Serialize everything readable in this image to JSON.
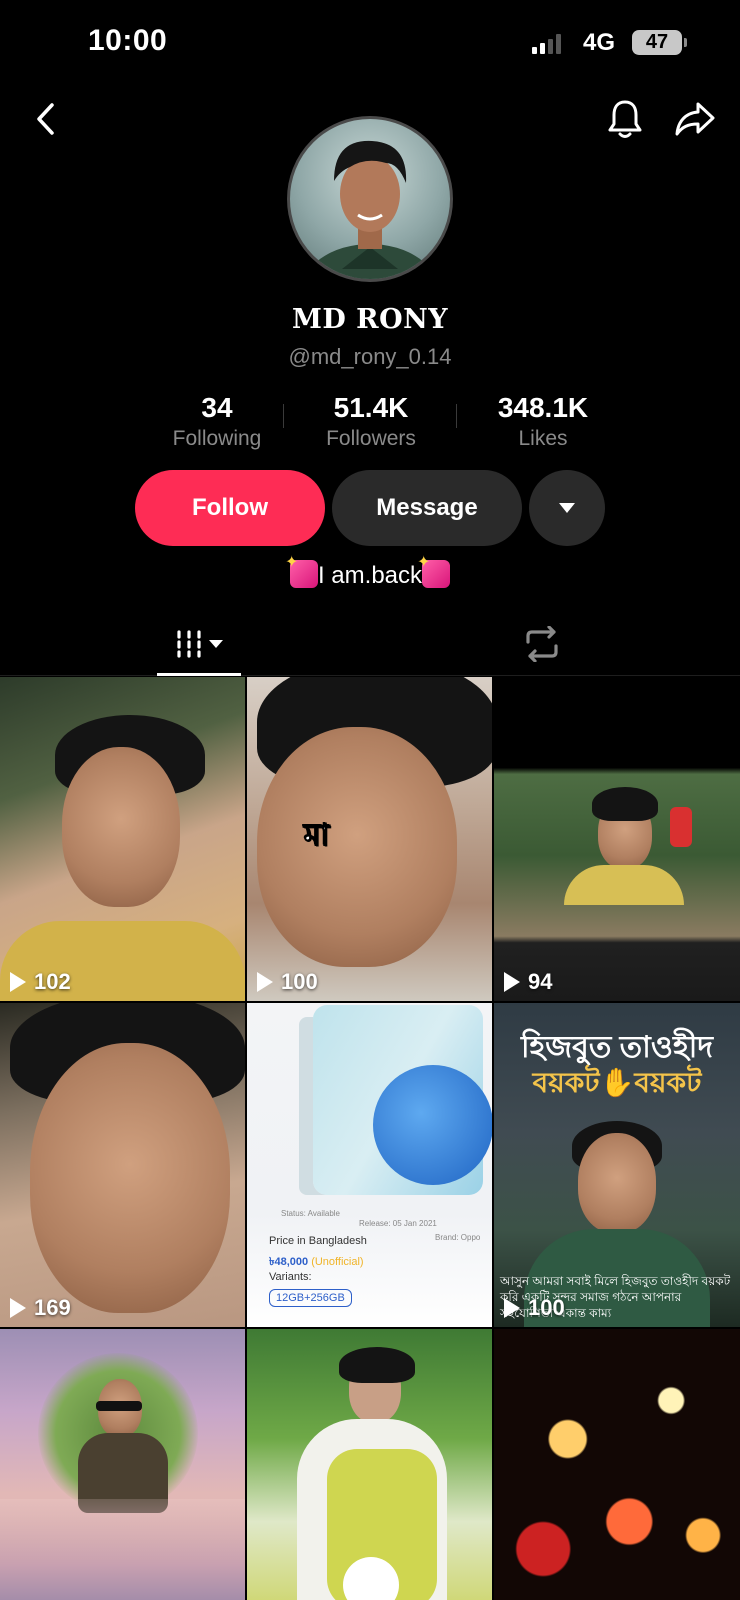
{
  "status_bar": {
    "time": "10:00",
    "network": "4G",
    "battery": "47"
  },
  "profile": {
    "name": "MD RONY",
    "handle": "@md_rony_0.14",
    "bio": "I am.back"
  },
  "stats": [
    {
      "value": "34",
      "label": "Following"
    },
    {
      "value": "51.4K",
      "label": "Followers"
    },
    {
      "value": "348.1K",
      "label": "Likes"
    }
  ],
  "actions": {
    "follow": "Follow",
    "message": "Message"
  },
  "tabs": [
    {
      "name": "videos",
      "icon": "grid-icon",
      "selected": true
    },
    {
      "name": "reposts",
      "icon": "repost-icon",
      "selected": false
    }
  ],
  "videos": [
    {
      "views": "102"
    },
    {
      "views": "100",
      "caption": "মা"
    },
    {
      "views": "94"
    },
    {
      "views": "169"
    },
    {
      "views": "",
      "price_label": "Price in Bangladesh",
      "price": "৳48,000",
      "price_note": "(Unofficial)",
      "variants_label": "Variants:",
      "variant": "12GB+256GB",
      "status": "Status: Available",
      "release": "Release: 05 Jan 2021",
      "brand": "Brand: Oppo"
    },
    {
      "views": "100",
      "banner_title": "হিজবুত তাওহীদ",
      "banner_sub": "বয়কট✋বয়কট",
      "banner_foot": "আসুন আমরা সবাই মিলে হিজবুত তাওহীদ বয়কট করি একটি সুন্দর সমাজ গঠনে আপনার সহযোগিতা একান্ত কাম্য"
    },
    {
      "views": ""
    },
    {
      "views": ""
    },
    {
      "views": ""
    }
  ],
  "colors": {
    "follow": "#fe2c55",
    "background": "#000000",
    "secondary_text": "#8a8a8a",
    "button_dark": "#2a2a2a"
  }
}
